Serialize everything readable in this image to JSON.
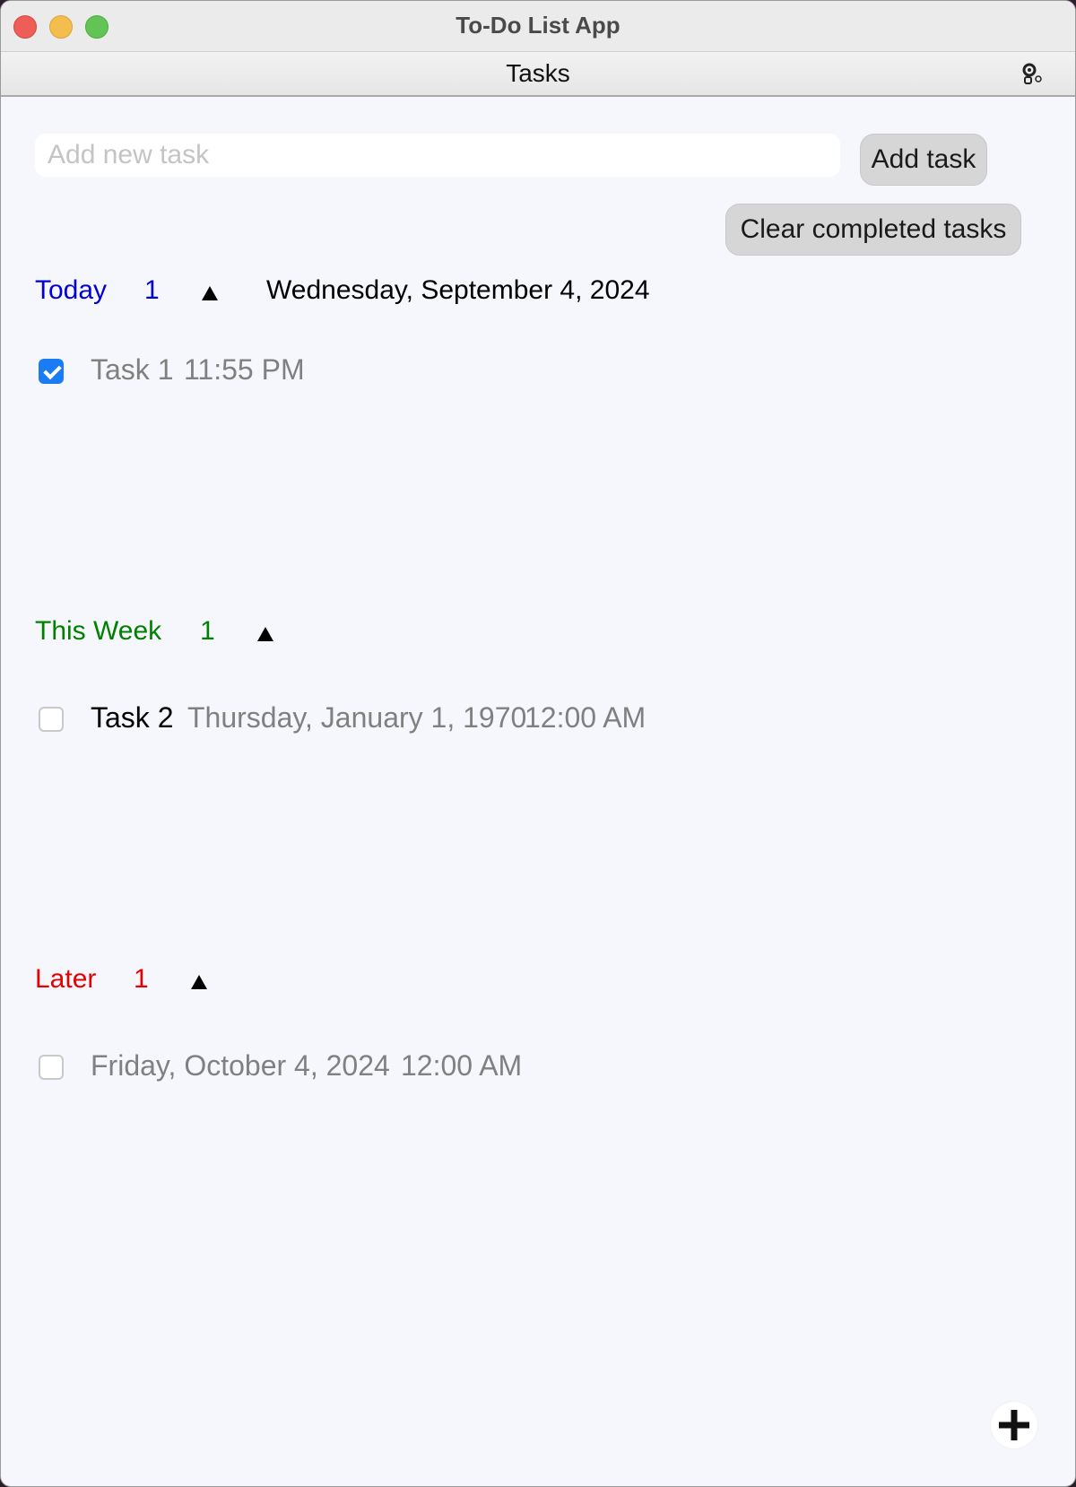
{
  "window": {
    "title": "To-Do List App"
  },
  "toolbar": {
    "title": "Tasks",
    "settings_icon": "gear-icon"
  },
  "new_task": {
    "placeholder": "Add new task",
    "value": "",
    "add_label": "Add task"
  },
  "clear_completed_label": "Clear completed tasks",
  "sections": {
    "today": {
      "name": "Today",
      "count": "1",
      "color": "#0000d6",
      "date": "Wednesday, September 4, 2024",
      "tasks": [
        {
          "checked": true,
          "title": "Task 1",
          "time": "11:55 PM"
        }
      ]
    },
    "this_week": {
      "name": "This Week",
      "count": "1",
      "color": "#008000",
      "tasks": [
        {
          "checked": false,
          "title": "Task 2",
          "date": "Thursday, January 1, 1970",
          "time": "12:00 AM"
        }
      ]
    },
    "later": {
      "name": "Later",
      "count": "1",
      "color": "#e60000",
      "tasks": [
        {
          "checked": false,
          "date": "Friday, October 4, 2024",
          "time": "12:00 AM"
        }
      ]
    }
  },
  "fab": {
    "icon": "plus-icon"
  }
}
